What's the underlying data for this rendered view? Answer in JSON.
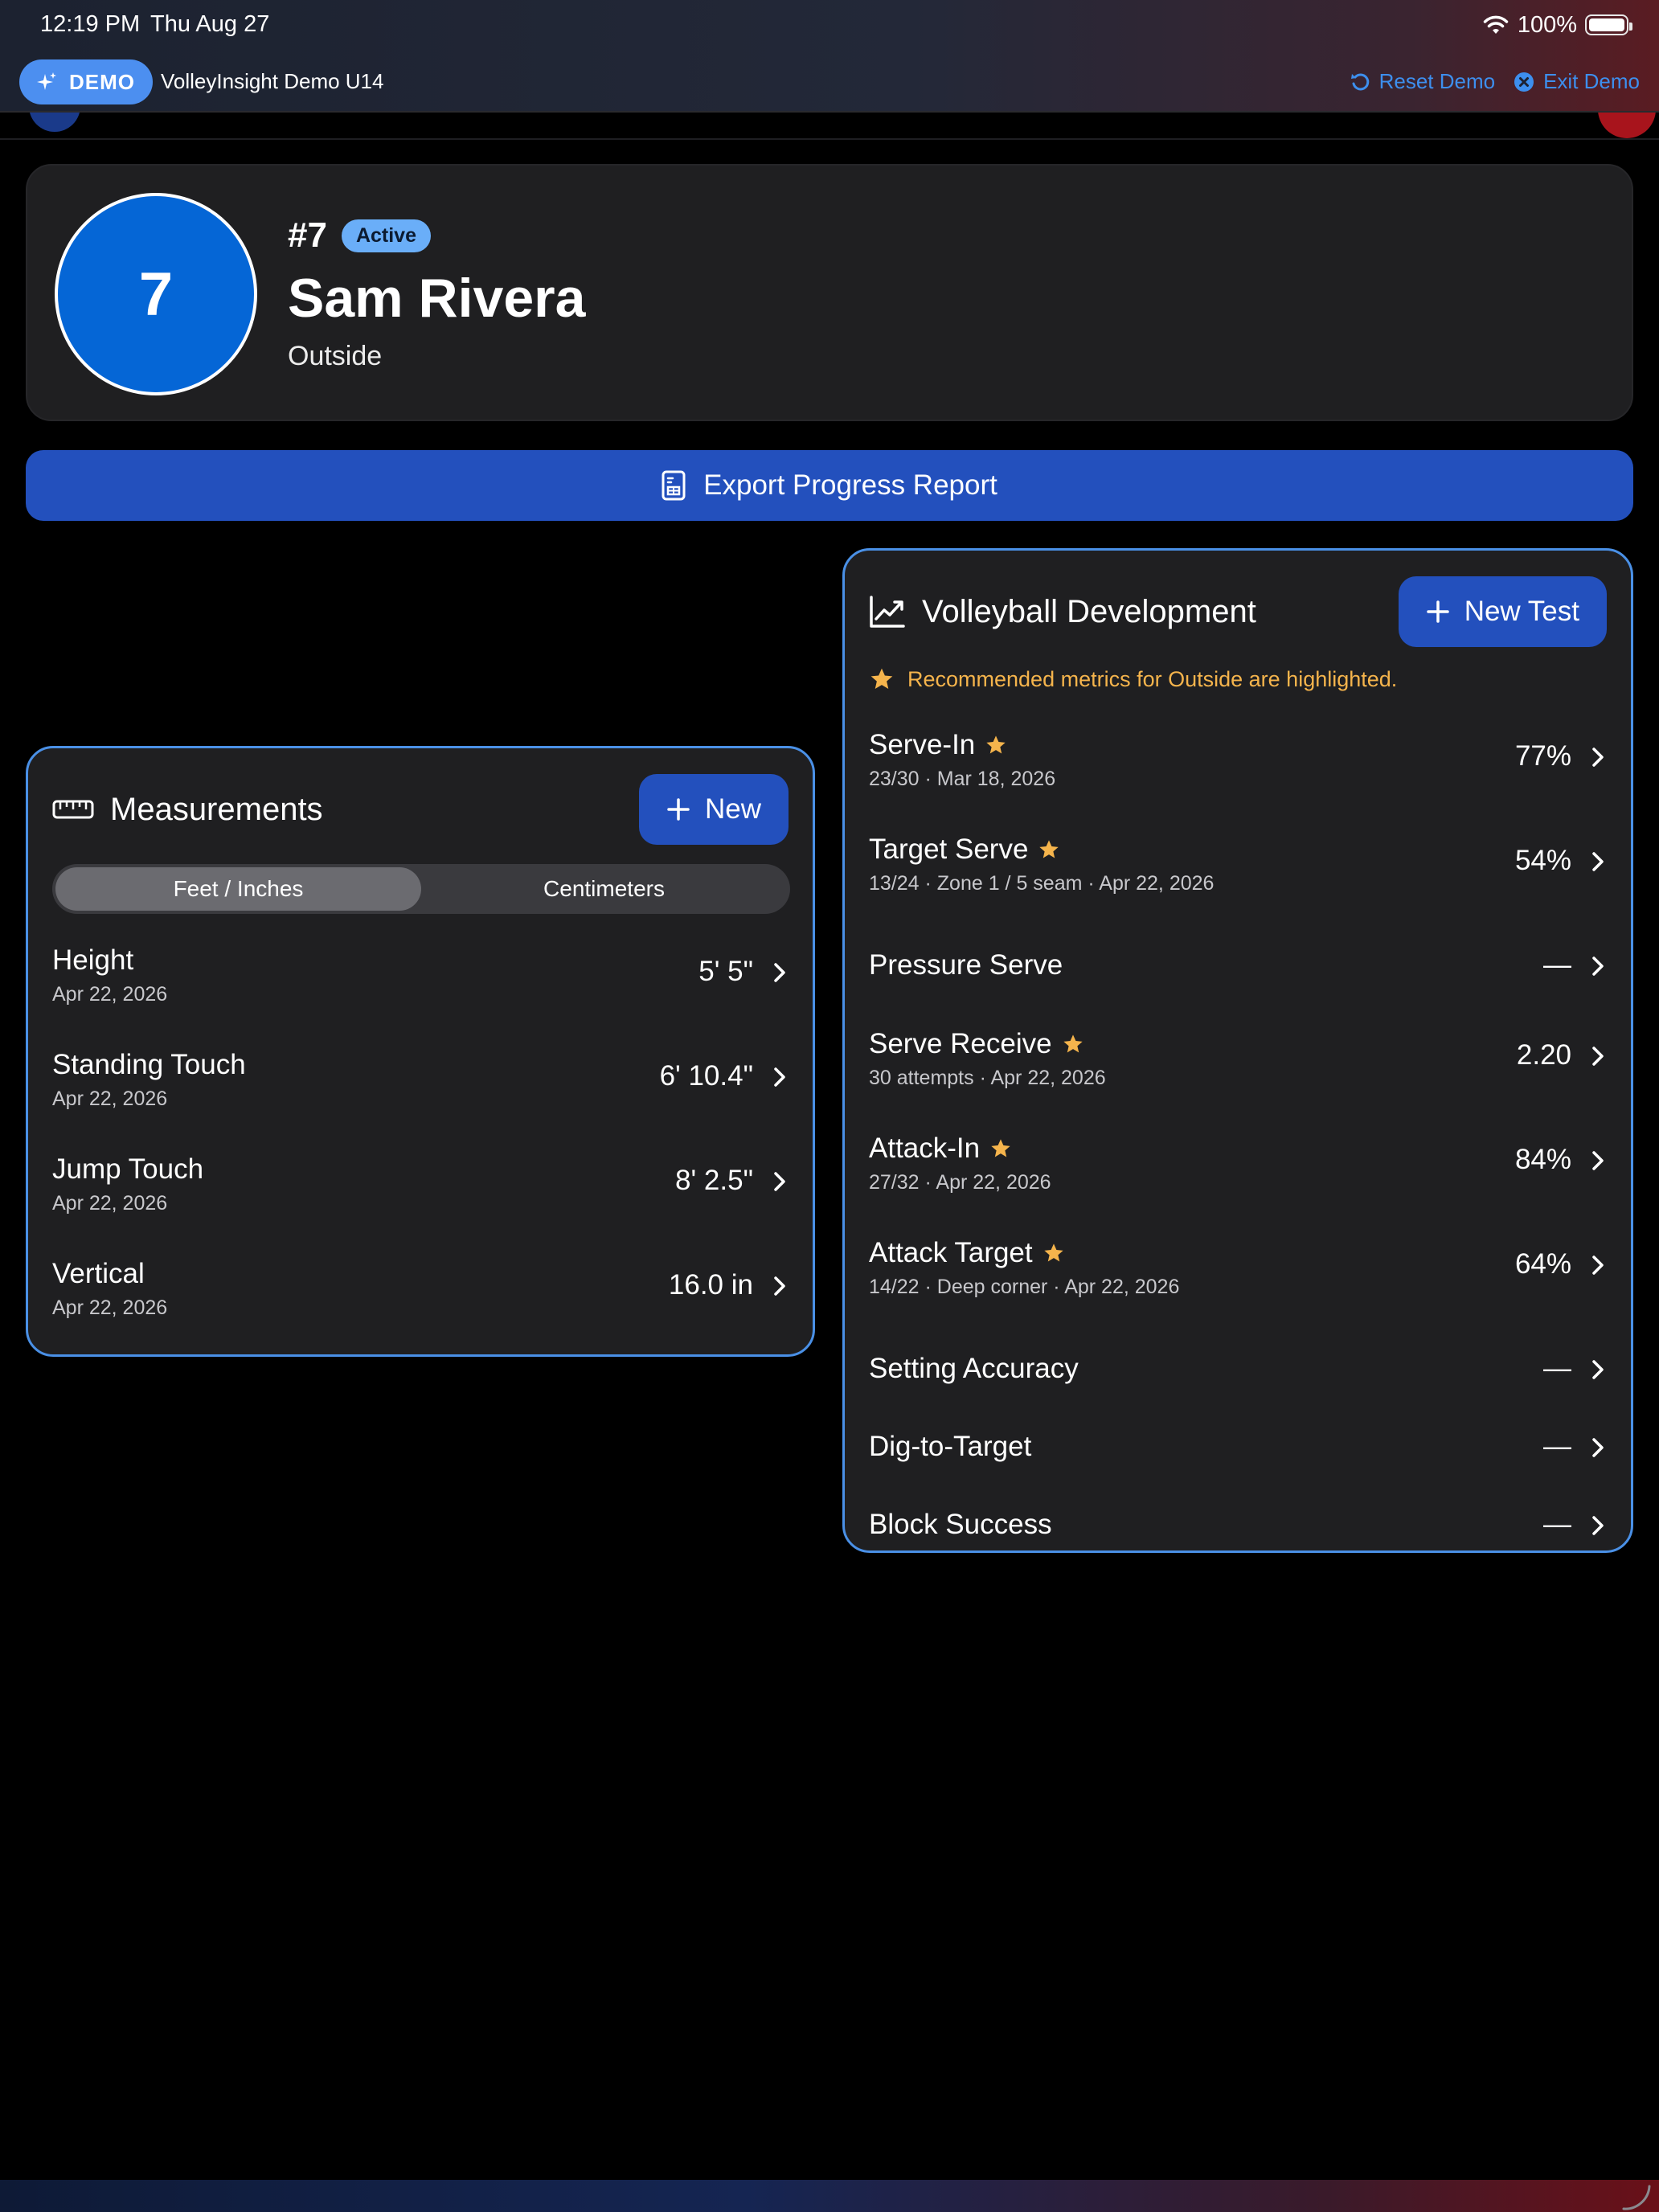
{
  "status": {
    "time": "12:19 PM",
    "date": "Thu Aug 27",
    "battery": "100%"
  },
  "demo": {
    "pill": "DEMO",
    "title": "VolleyInsight Demo U14",
    "reset": "Reset Demo",
    "exit": "Exit Demo"
  },
  "player": {
    "avatar": "7",
    "number": "#7",
    "status": "Active",
    "name": "Sam Rivera",
    "position": "Outside"
  },
  "export": {
    "label": "Export Progress Report"
  },
  "measurements": {
    "title": "Measurements",
    "new_label": "New",
    "units": [
      "Feet / Inches",
      "Centimeters"
    ],
    "items": [
      {
        "name": "Height",
        "date": "Apr 22, 2026",
        "value": "5' 5\""
      },
      {
        "name": "Standing Touch",
        "date": "Apr 22, 2026",
        "value": "6' 10.4\""
      },
      {
        "name": "Jump Touch",
        "date": "Apr 22, 2026",
        "value": "8' 2.5\""
      },
      {
        "name": "Vertical",
        "date": "Apr 22, 2026",
        "value": "16.0 in"
      }
    ]
  },
  "development": {
    "title": "Volleyball Development",
    "new_label": "New Test",
    "note": "Recommended metrics for Outside are highlighted.",
    "items": [
      {
        "name": "Serve-In",
        "detail": "23/30 · Mar 18, 2026",
        "value": "77%",
        "recommended": true
      },
      {
        "name": "Target Serve",
        "detail": "13/24 · Zone 1 / 5 seam · Apr 22, 2026",
        "value": "54%",
        "recommended": true
      },
      {
        "name": "Pressure Serve",
        "detail": "",
        "value": "—",
        "recommended": false
      },
      {
        "name": "Serve Receive",
        "detail": "30 attempts · Apr 22, 2026",
        "value": "2.20",
        "recommended": true
      },
      {
        "name": "Attack-In",
        "detail": "27/32 · Apr 22, 2026",
        "value": "84%",
        "recommended": true
      },
      {
        "name": "Attack Target",
        "detail": "14/22 · Deep corner · Apr 22, 2026",
        "value": "64%",
        "recommended": true
      },
      {
        "name": "Setting Accuracy",
        "detail": "",
        "value": "—",
        "recommended": false
      },
      {
        "name": "Dig-to-Target",
        "detail": "",
        "value": "—",
        "recommended": false
      },
      {
        "name": "Block Success",
        "detail": "",
        "value": "—",
        "recommended": false
      }
    ]
  },
  "icons": {
    "sparkle": "sparkle-icon",
    "reset": "reset-icon",
    "exit": "close-circle-icon",
    "wifi": "wifi-icon",
    "battery": "battery-icon",
    "report": "report-icon",
    "ruler": "ruler-icon",
    "chart": "chart-line-icon",
    "plus": "plus-icon",
    "star": "star-icon",
    "chevron": "chevron-right-icon"
  },
  "colors": {
    "accent": "#2350bd",
    "link": "#3d8fee",
    "panel_border": "#4a90e6",
    "star": "#f5b44c",
    "avatar": "#0566d6",
    "badge": "#6aaef8"
  }
}
